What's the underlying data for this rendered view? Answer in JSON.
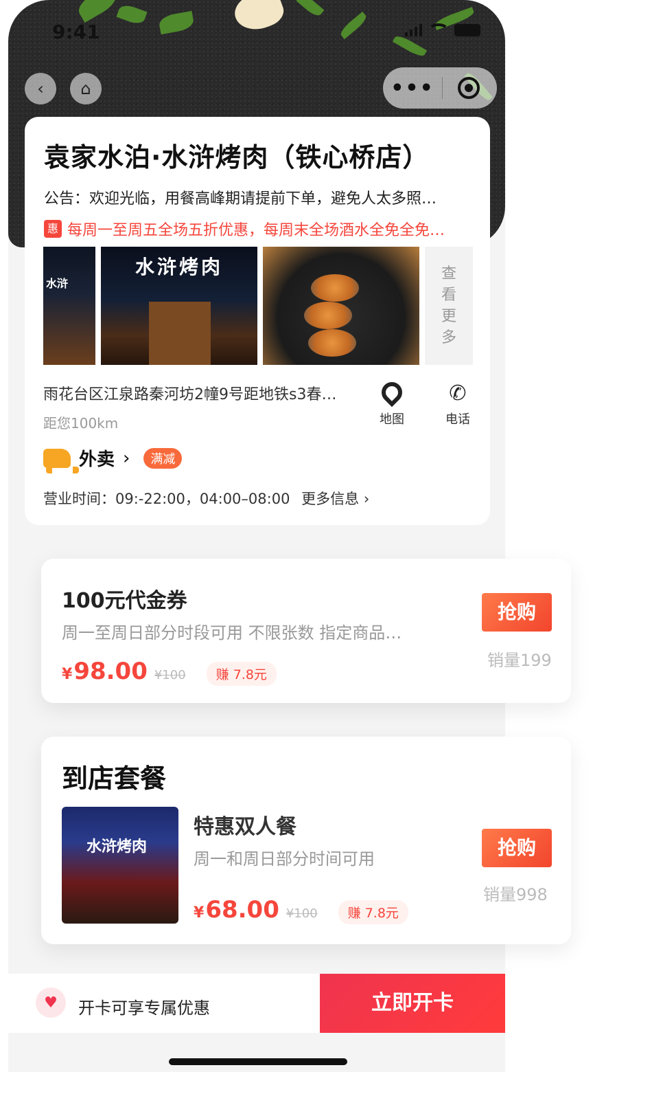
{
  "status_bar": {
    "time": "9:41"
  },
  "nav": {
    "back_icon": "back-icon",
    "home_icon": "home-icon",
    "more_label": "•••",
    "target_icon": "target-icon"
  },
  "store": {
    "title": "袁家水泊·水浒烤肉（铁心桥店）",
    "notice": "公告：欢迎光临，用餐高峰期请提前下单，避免人太多照…",
    "promo_badge": "惠",
    "promo": "每周一至周五全场五折优惠，每周末全场酒水全免全免…",
    "photo_sign": "水浒烤肉",
    "photo_sign_short": "水浒",
    "see_more": [
      "查",
      "看",
      "更",
      "多"
    ],
    "address": "雨花台区江泉路秦河坊2幢9号距地铁s3春…",
    "distance": "距您100km",
    "map_label": "地图",
    "phone_label": "电话",
    "takeout_label": "外卖",
    "takeout_badge": "满减",
    "hours": "营业时间：09:-22:00，04:00–08:00",
    "more_info": "更多信息"
  },
  "voucher": {
    "title": "100元代金券",
    "desc": "周一至周日部分时段可用 不限张数 指定商品…",
    "currency": "¥",
    "price": "98.00",
    "original": "¥100",
    "earn": "赚 7.8元",
    "buy_label": "抢购",
    "sales": "销量199"
  },
  "package": {
    "section_title": "到店套餐",
    "thumb_sign": "水浒烤肉",
    "name": "特惠双人餐",
    "desc": "周一和周日部分时间可用",
    "currency": "¥",
    "price": "68.00",
    "original": "¥100",
    "earn": "赚 7.8元",
    "buy_label": "抢购",
    "sales": "销量998"
  },
  "bottom": {
    "label": "开卡可享专属优惠",
    "cta": "立即开卡"
  },
  "colors": {
    "accent": "#f5463c",
    "cta": "#f0344f",
    "takeout": "#f6a623"
  }
}
